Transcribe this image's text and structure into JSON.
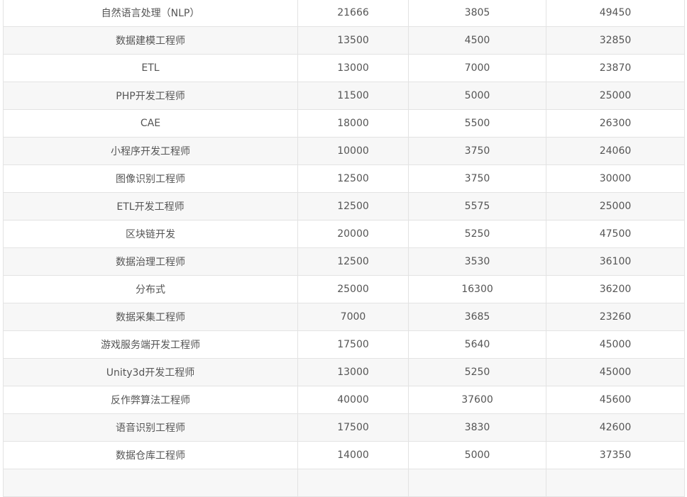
{
  "table": {
    "rows": [
      {
        "title": "自然语言处理（NLP）",
        "a": "21666",
        "b": "3805",
        "c": "49450"
      },
      {
        "title": "数据建模工程师",
        "a": "13500",
        "b": "4500",
        "c": "32850"
      },
      {
        "title": "ETL",
        "a": "13000",
        "b": "7000",
        "c": "23870"
      },
      {
        "title": "PHP开发工程师",
        "a": "11500",
        "b": "5000",
        "c": "25000"
      },
      {
        "title": "CAE",
        "a": "18000",
        "b": "5500",
        "c": "26300"
      },
      {
        "title": "小程序开发工程师",
        "a": "10000",
        "b": "3750",
        "c": "24060"
      },
      {
        "title": "图像识别工程师",
        "a": "12500",
        "b": "3750",
        "c": "30000"
      },
      {
        "title": "ETL开发工程师",
        "a": "12500",
        "b": "5575",
        "c": "25000"
      },
      {
        "title": "区块链开发",
        "a": "20000",
        "b": "5250",
        "c": "47500"
      },
      {
        "title": "数据治理工程师",
        "a": "12500",
        "b": "3530",
        "c": "36100"
      },
      {
        "title": "分布式",
        "a": "25000",
        "b": "16300",
        "c": "36200"
      },
      {
        "title": "数据采集工程师",
        "a": "7000",
        "b": "3685",
        "c": "23260"
      },
      {
        "title": "游戏服务端开发工程师",
        "a": "17500",
        "b": "5640",
        "c": "45000"
      },
      {
        "title": "Unity3d开发工程师",
        "a": "13000",
        "b": "5250",
        "c": "45000"
      },
      {
        "title": "反作弊算法工程师",
        "a": "40000",
        "b": "37600",
        "c": "45600"
      },
      {
        "title": "语音识别工程师",
        "a": "17500",
        "b": "3830",
        "c": "42600"
      },
      {
        "title": "数据仓库工程师",
        "a": "14000",
        "b": "5000",
        "c": "37350"
      },
      {
        "title": "",
        "a": "",
        "b": "",
        "c": ""
      }
    ]
  }
}
